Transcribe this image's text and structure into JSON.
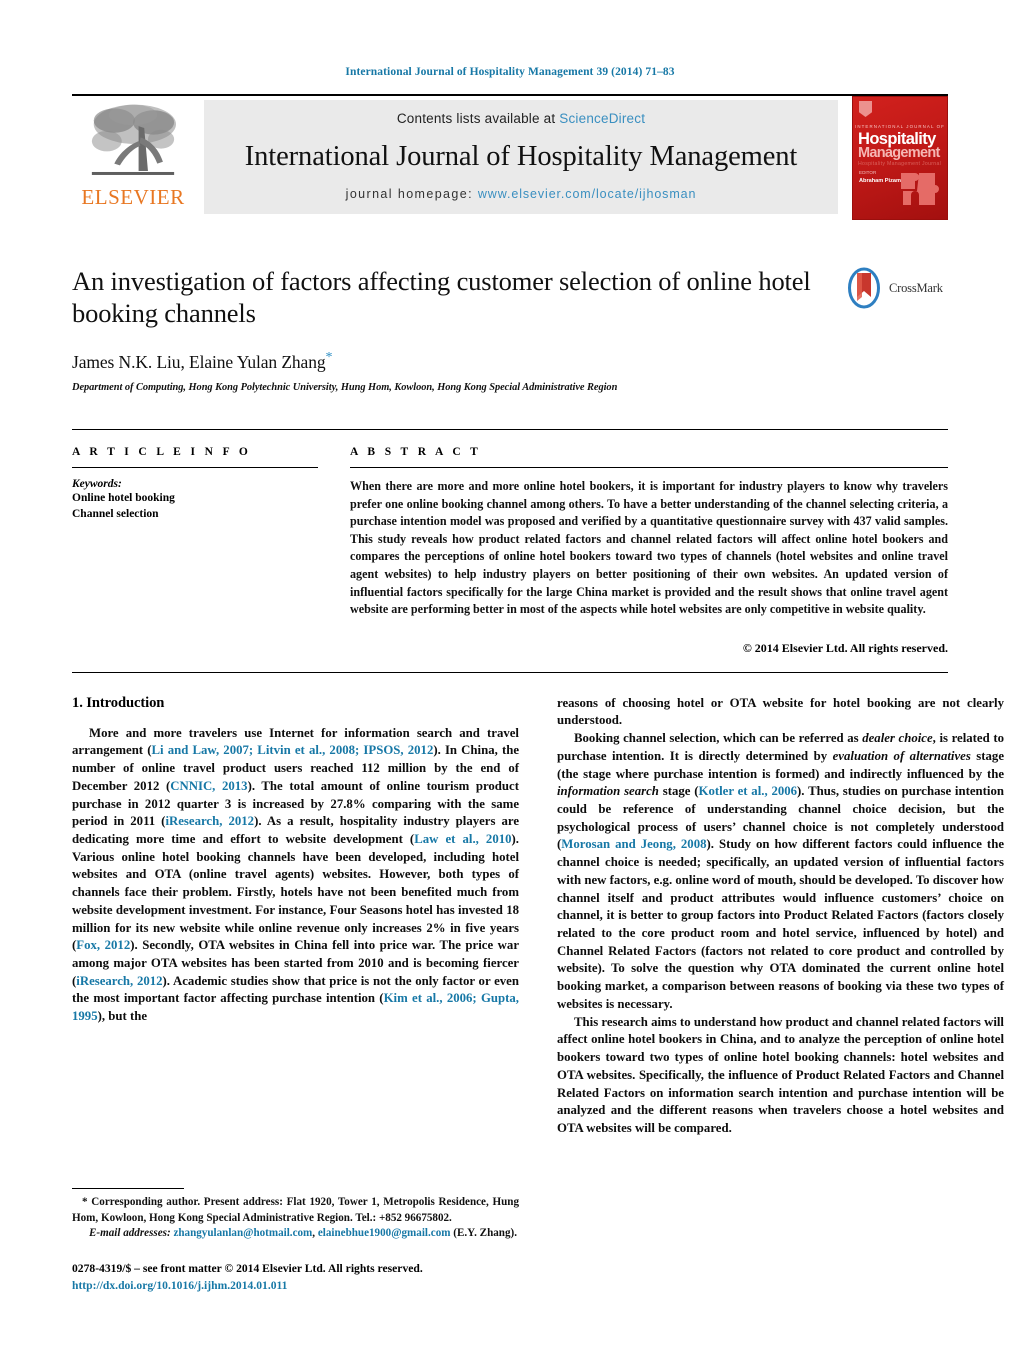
{
  "running_head": "International Journal of Hospitality Management 39 (2014) 71–83",
  "masthead": {
    "publisher": "ELSEVIER",
    "contents_prefix": "Contents lists available at ",
    "contents_link": "ScienceDirect",
    "journal_name": "International Journal of Hospitality Management",
    "homepage_label": "journal homepage:",
    "homepage_url": "www.elsevier.com/locate/ijhosman",
    "cover": {
      "subtitle": "INTERNATIONAL JOURNAL OF",
      "line1": "Hospitality",
      "line2": "Management",
      "line3": "Hospitality Management Journal",
      "editor_label": "EDITOR",
      "editor_name": "Abraham Pizam"
    }
  },
  "crossmark": {
    "label": "CrossMark"
  },
  "article": {
    "title": "An investigation of factors affecting customer selection of online hotel booking channels",
    "authors": "James N.K. Liu, Elaine Yulan Zhang",
    "corresponding_marker": "*",
    "affiliation": "Department of Computing, Hong Kong Polytechnic University, Hung Hom, Kowloon, Hong Kong Special Administrative Region"
  },
  "article_info": {
    "heading": "A R T I C L E    I N F O",
    "keywords_label": "Keywords:",
    "keywords": [
      "Online hotel booking",
      "Channel selection"
    ]
  },
  "abstract": {
    "heading": "A B S T R A C T",
    "text": "When there are more and more online hotel bookers, it is important for industry players to know why travelers prefer one online booking channel among others. To have a better understanding of the channel selecting criteria, a purchase intention model was proposed and verified by a quantitative questionnaire survey with 437 valid samples. This study reveals how product related factors and channel related factors will affect online hotel bookers and compares the perceptions of online hotel bookers toward two types of channels (hotel websites and online travel agent websites) to help industry players on better positioning of their own websites. An updated version of influential factors specifically for the large China market is provided and the result shows that online travel agent website are performing better in most of the aspects while hotel websites are only competitive in website quality.",
    "copyright": "© 2014 Elsevier Ltd. All rights reserved."
  },
  "body": {
    "section_number_title": "1.  Introduction",
    "left_paragraph_1_a": "More and more travelers use Internet for information search and travel arrangement (",
    "left_ref_1": "Li and Law, 2007; Litvin et al., 2008; IPSOS, 2012",
    "left_paragraph_1_b": "). In China, the number of online travel product users reached 112 million by the end of December 2012 (",
    "left_ref_2": "CNNIC, 2013",
    "left_paragraph_1_c": "). The total amount of online tourism product purchase in 2012 quarter 3 is increased by 27.8% comparing with the same period in 2011 (",
    "left_ref_3": "iResearch, 2012",
    "left_paragraph_1_d": "). As a result, hospitality industry players are dedicating more time and effort to website development (",
    "left_ref_4": "Law et al., 2010",
    "left_paragraph_1_e": "). Various online hotel booking channels have been developed, including hotel websites and OTA (online travel agents) websites. However, both types of channels face their problem. Firstly, hotels have not been benefited much from website development investment. For instance, Four Seasons hotel has invested 18 million for its new website while online revenue only increases 2% in five years (",
    "left_ref_5": "Fox, 2012",
    "left_paragraph_1_f": "). Secondly, OTA websites in China fell into price war. The price war among major OTA websites has been started from 2010 and is becoming fiercer (",
    "left_ref_6": "iResearch, 2012",
    "left_paragraph_1_g": "). Academic studies show that price is not the only factor or even the most important factor affecting purchase intention (",
    "left_ref_7": "Kim et al., 2006; Gupta, 1995",
    "left_paragraph_1_h": "), but the",
    "right_paragraph_1": "reasons of choosing hotel or OTA website for hotel booking are not clearly understood.",
    "right_paragraph_2_a": "Booking channel selection, which can be referred as ",
    "right_italic_1": "dealer choice",
    "right_paragraph_2_b": ", is related to purchase intention. It is directly determined by ",
    "right_italic_2": "evaluation of alternatives",
    "right_paragraph_2_c": " stage (the stage where purchase intention is formed) and indirectly influenced by the ",
    "right_italic_3": "information search",
    "right_paragraph_2_d": " stage (",
    "right_ref_1": "Kotler et al., 2006",
    "right_paragraph_2_e": "). Thus, studies on purchase intention could be reference of understanding channel choice decision, but the psychological process of users’ channel choice is not completely understood (",
    "right_ref_2": "Morosan and Jeong, 2008",
    "right_paragraph_2_f": "). Study on how different factors could influence the channel choice is needed; specifically, an updated version of influential factors with new factors, e.g. online word of mouth, should be developed. To discover how channel itself and product attributes would influence customers’ choice on channel, it is better to group factors into Product Related Factors (factors closely related to the core product room and hotel service, influenced by hotel) and Channel Related Factors (factors not related to core product and controlled by website). To solve the question why OTA dominated the current online hotel booking market, a comparison between reasons of booking via these two types of websites is necessary.",
    "right_paragraph_3": "This research aims to understand how product and channel related factors will affect online hotel bookers in China, and to analyze the perception of online hotel bookers toward two types of online hotel booking channels: hotel websites and OTA websites. Specifically, the influence of Product Related Factors and Channel Related Factors on information search intention and purchase intention will be analyzed and the different reasons when travelers choose a hotel websites and OTA websites will be compared."
  },
  "footnote": {
    "corresponding_marker": "*",
    "corresponding_text": " Corresponding author. Present address: Flat 1920, Tower 1, Metropolis Residence, Hung Hom, Kowloon, Hong Kong Special Administrative Region. Tel.: +852 96675802.",
    "email_label": "E-mail addresses:",
    "email_1": "zhangyulanlan@hotmail.com",
    "email_sep": ", ",
    "email_2": "elainebhue1900@gmail.com",
    "email_suffix": " (E.Y. Zhang)."
  },
  "issn": {
    "line": "0278-4319/$ – see front matter © 2014 Elsevier Ltd. All rights reserved.",
    "doi": "http://dx.doi.org/10.1016/j.ijhm.2014.01.011"
  },
  "colors": {
    "link": "#1778a6",
    "accent_orange": "#e87722",
    "cover_red": "#c01917",
    "masthead_gray": "#eaeaea"
  }
}
